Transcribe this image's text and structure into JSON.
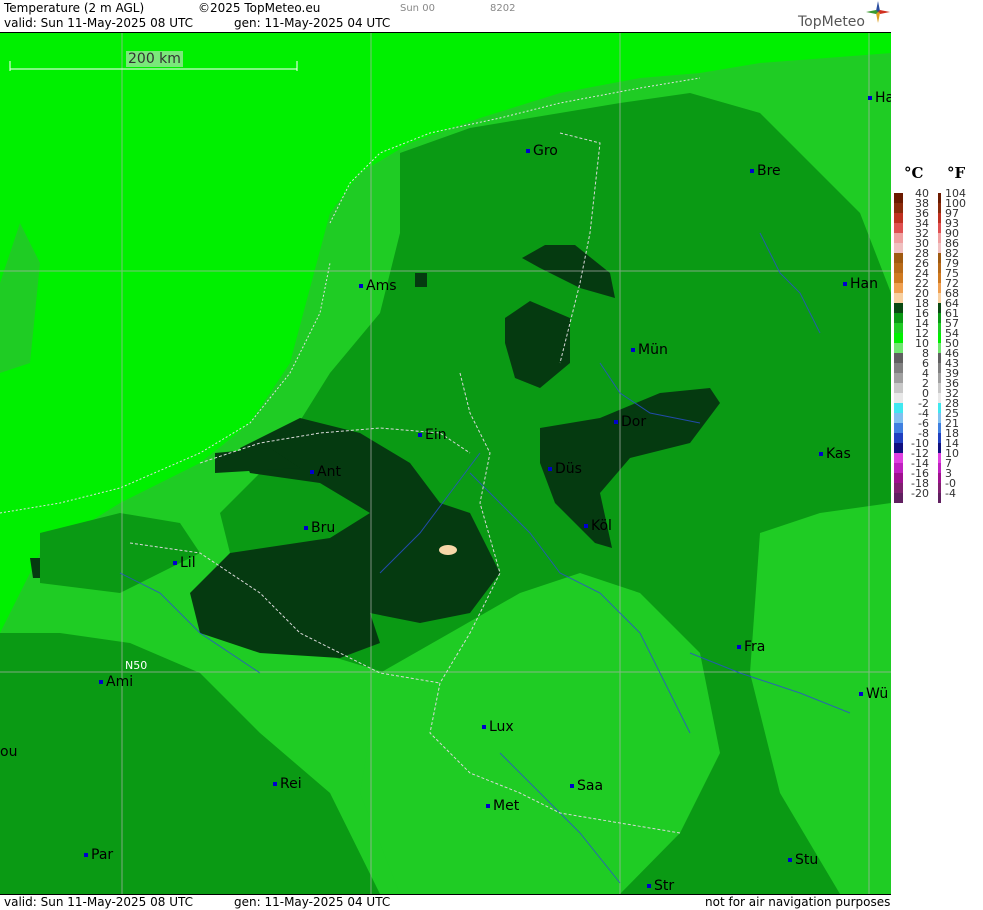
{
  "header": {
    "title": "Temperature (2 m AGL)",
    "copyright": "©2025 TopMeteo.eu",
    "run": "Sun 00",
    "code": "8202",
    "valid": "valid:  Sun  11-May-2025  08 UTC",
    "gen": "gen: 11-May-2025 04 UTC",
    "logo": "TopMeteo"
  },
  "map": {
    "scale_label": "200 km",
    "lat_label": "N50",
    "colors": {
      "light": "#00f000",
      "mid": "#1fcc24",
      "dark": "#0a9a14",
      "darkest": "#053a10"
    },
    "cities": [
      {
        "name": "Gro"
      },
      {
        "name": "Bre"
      },
      {
        "name": "Ha"
      },
      {
        "name": "Ams"
      },
      {
        "name": "Han"
      },
      {
        "name": "Mün"
      },
      {
        "name": "Ein"
      },
      {
        "name": "Dor"
      },
      {
        "name": "Ant"
      },
      {
        "name": "Düs"
      },
      {
        "name": "Kas"
      },
      {
        "name": "Bru"
      },
      {
        "name": "Köl"
      },
      {
        "name": "Lil"
      },
      {
        "name": "Ami"
      },
      {
        "name": "Fra"
      },
      {
        "name": "Wü"
      },
      {
        "name": "ou"
      },
      {
        "name": "Lux"
      },
      {
        "name": "Rei"
      },
      {
        "name": "Saa"
      },
      {
        "name": "Met"
      },
      {
        "name": "Par"
      },
      {
        "name": "Stu"
      },
      {
        "name": "Str"
      }
    ]
  },
  "footer": {
    "valid": "valid:  Sun  11-May-2025  08 UTC",
    "gen": "gen: 11-May-2025 04 UTC",
    "note": "not for air navigation purposes"
  },
  "legend": {
    "c_unit": "°C",
    "f_unit": "°F",
    "c_labels": [
      "40",
      "38",
      "36",
      "34",
      "32",
      "30",
      "28",
      "26",
      "24",
      "22",
      "20",
      "18",
      "16",
      "14",
      "12",
      "10",
      "8",
      "6",
      "4",
      "2",
      "0",
      "-2",
      "-4",
      "-6",
      "-8",
      "-10",
      "-12",
      "-14",
      "-16",
      "-18",
      "-20"
    ],
    "f_labels": [
      "104",
      "100",
      "97",
      "93",
      "90",
      "86",
      "82",
      "79",
      "75",
      "72",
      "68",
      "64",
      "61",
      "57",
      "54",
      "50",
      "46",
      "43",
      "39",
      "36",
      "32",
      "28",
      "25",
      "21",
      "18",
      "14",
      "10",
      "7",
      "3",
      "-0",
      "-4"
    ],
    "colors": [
      "#6b1a00",
      "#8a2a0a",
      "#c03020",
      "#e05050",
      "#f0a0a0",
      "#f0c0c0",
      "#a05a10",
      "#b86a18",
      "#d07a20",
      "#f0a050",
      "#f8d0a0",
      "#0a4a12",
      "#0a9a14",
      "#1fcc24",
      "#00f000",
      "#70e870",
      "#606060",
      "#808080",
      "#a0a0a0",
      "#c8c8c8",
      "#e8e8e8",
      "#40e8f0",
      "#80c0f0",
      "#4080e0",
      "#2040c0",
      "#101080",
      "#e040e0",
      "#c020c0",
      "#a01090",
      "#802070",
      "#602060"
    ]
  }
}
